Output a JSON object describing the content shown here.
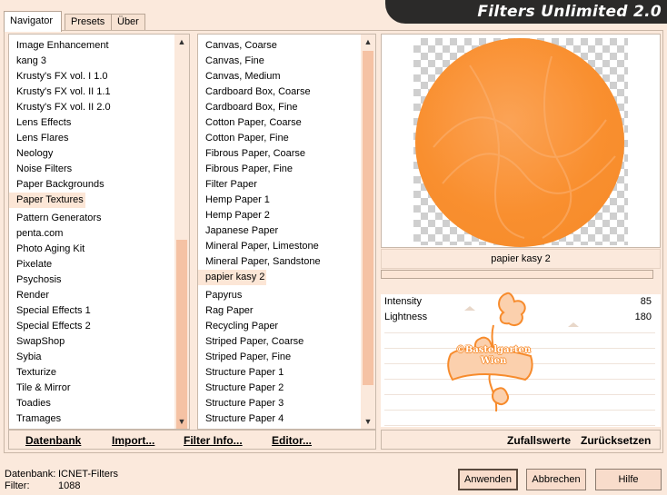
{
  "tabs": [
    "Navigator",
    "Presets",
    "Über"
  ],
  "banner": {
    "title": "Filters Unlimited 2.0"
  },
  "categories": [
    "Image Enhancement",
    "kang 3",
    "Krusty's FX vol. I 1.0",
    "Krusty's FX vol. II 1.1",
    "Krusty's FX vol. II 2.0",
    "Lens Effects",
    "Lens Flares",
    "Neology",
    "Noise Filters",
    "Paper Backgrounds",
    "Paper Textures",
    "Pattern Generators",
    "penta.com",
    "Photo Aging Kit",
    "Pixelate",
    "Psychosis",
    "Render",
    "Special Effects 1",
    "Special Effects 2",
    "SwapShop",
    "Sybia",
    "Texturize",
    "Tile & Mirror",
    "Toadies",
    "Tramages"
  ],
  "selected_category": "Paper Textures",
  "filters": [
    "Canvas, Coarse",
    "Canvas, Fine",
    "Canvas, Medium",
    "Cardboard Box, Coarse",
    "Cardboard Box, Fine",
    "Cotton Paper, Coarse",
    "Cotton Paper, Fine",
    "Fibrous Paper, Coarse",
    "Fibrous Paper, Fine",
    "Filter Paper",
    "Hemp Paper 1",
    "Hemp Paper 2",
    "Japanese Paper",
    "Mineral Paper, Limestone",
    "Mineral Paper, Sandstone",
    "papier kasy 2",
    "Papyrus",
    "Rag Paper",
    "Recycling Paper",
    "Striped Paper, Coarse",
    "Striped Paper, Fine",
    "Structure Paper 1",
    "Structure Paper 2",
    "Structure Paper 3",
    "Structure Paper 4"
  ],
  "selected_filter": "papier kasy 2",
  "bottom_buttons": [
    "Datenbank",
    "Import...",
    "Filter Info...",
    "Editor..."
  ],
  "current_filter_label": "papier kasy 2",
  "sliders": [
    {
      "label": "Intensity",
      "value": "85",
      "level": 85
    },
    {
      "label": "Lightness",
      "value": "180",
      "level": 180
    }
  ],
  "watermark": {
    "line1": "©Bastelgarten",
    "line2": "Wien"
  },
  "right_buttons": [
    "Zufallswerte",
    "Zurücksetzen"
  ],
  "status": {
    "db_label": "Datenbank:",
    "db_value": "ICNET-Filters",
    "filter_label": "Filter:",
    "filter_value": "1088"
  },
  "dialog_buttons": {
    "apply": "Anwenden",
    "cancel": "Abbrechen",
    "help": "Hilfe"
  },
  "colors": {
    "accent": "#f7922f",
    "panel": "#fbe9dc",
    "banner": "#2b2a29"
  }
}
